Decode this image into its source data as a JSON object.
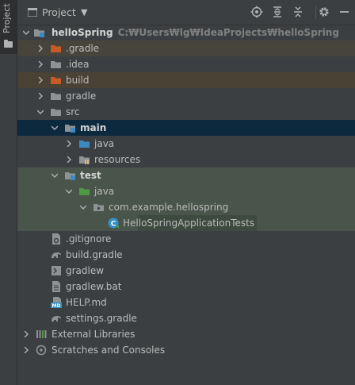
{
  "toolwindow": {
    "strip_label": "Project",
    "title": "Project",
    "caret": "▼"
  },
  "toolbar": {
    "icons": [
      "locate-icon",
      "expand-all-icon",
      "collapse-all-icon",
      "gear-icon",
      "hide-icon"
    ]
  },
  "tree": {
    "root": {
      "label": "helloSpring",
      "path": "C:₩Users₩lg₩IdeaProjects₩helloSpring"
    },
    "items": [
      {
        "label": ".gradle"
      },
      {
        "label": ".idea"
      },
      {
        "label": "build"
      },
      {
        "label": "gradle"
      },
      {
        "label": "src"
      },
      {
        "label": "main"
      },
      {
        "label": "java"
      },
      {
        "label": "resources"
      },
      {
        "label": "test"
      },
      {
        "label": "java"
      },
      {
        "label": "com.example.hellospring"
      },
      {
        "label": "HelloSpringApplicationTests"
      },
      {
        "label": ".gitignore"
      },
      {
        "label": "build.gradle"
      },
      {
        "label": "gradlew"
      },
      {
        "label": "gradlew.bat"
      },
      {
        "label": "HELP.md"
      },
      {
        "label": "settings.gradle"
      },
      {
        "label": "External Libraries"
      },
      {
        "label": "Scratches and Consoles"
      }
    ]
  },
  "colors": {
    "background": "#3c3f41",
    "selection": "#0d293e",
    "excluded": "#47453b",
    "test_root": "#49544a",
    "source_folder": "#3b8ac2",
    "test_folder": "#4e9a42",
    "excluded_folder": "#c75a26",
    "folder": "#8f9294"
  }
}
